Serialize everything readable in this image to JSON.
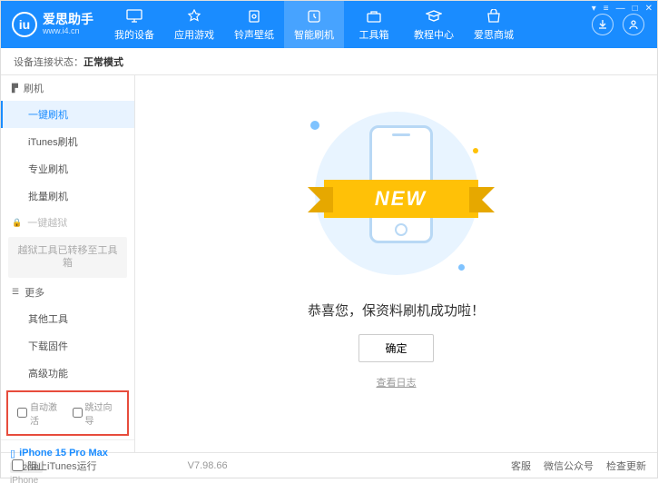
{
  "logo": {
    "title": "爱思助手",
    "url": "www.i4.cn",
    "icon_text": "iu"
  },
  "nav": [
    {
      "label": "我的设备"
    },
    {
      "label": "应用游戏"
    },
    {
      "label": "铃声壁纸"
    },
    {
      "label": "智能刷机"
    },
    {
      "label": "工具箱"
    },
    {
      "label": "教程中心"
    },
    {
      "label": "爱思商城"
    }
  ],
  "status": {
    "label": "设备连接状态：",
    "mode": "正常模式"
  },
  "sidebar": {
    "flash_header": "刷机",
    "flash_items": [
      "一键刷机",
      "iTunes刷机",
      "专业刷机",
      "批量刷机"
    ],
    "jailbreak_header": "一键越狱",
    "jailbreak_note": "越狱工具已转移至工具箱",
    "more_header": "更多",
    "more_items": [
      "其他工具",
      "下载固件",
      "高级功能"
    ],
    "checkboxes": {
      "auto_activate": "自动激活",
      "skip_setup": "跳过向导"
    }
  },
  "device": {
    "name": "iPhone 15 Pro Max",
    "storage": "512GB",
    "type": "iPhone"
  },
  "main": {
    "ribbon": "NEW",
    "success": "恭喜您，保资料刷机成功啦！",
    "ok": "确定",
    "log": "查看日志"
  },
  "footer": {
    "block_itunes": "阻止iTunes运行",
    "version": "V7.98.66",
    "links": [
      "客服",
      "微信公众号",
      "检查更新"
    ]
  }
}
